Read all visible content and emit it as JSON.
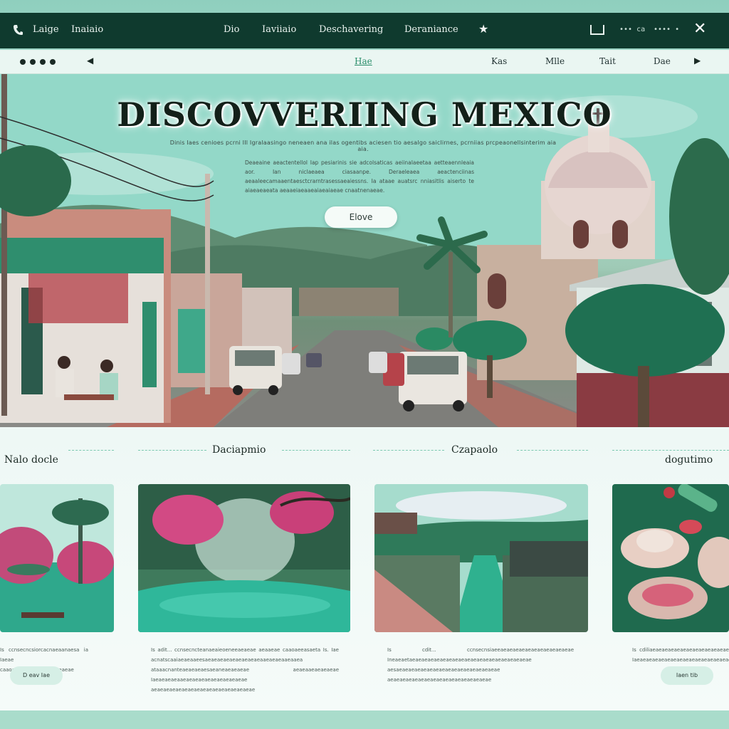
{
  "topbar": {
    "items": [
      "Laige",
      "Inaiaio",
      "Dio",
      "Iaviiaio",
      "Deschavering",
      "Deraniance"
    ],
    "small_left": "••• ca",
    "small_right": "•••• •"
  },
  "subnav": {
    "items": [
      "Hae",
      "Kas",
      "Mlle",
      "Tait",
      "Dae"
    ]
  },
  "hero": {
    "title": "DISCOVVERIING  MEXICO",
    "lede": "Dinis Iaes cenioes pcrni IIl Igralaasingo neneaen ana ilas ogentibs aciesen tio aesalgo saiclirnes, pcrniias prcpeaonellsinterim aia aia.",
    "paragraph": "Deaeaine aeactentellol Iap pesiarinis sie adcolsaticas aeiinaIaeetaa aetteaennleaia aor. Ian niclaeaea ciasaanpe. Deraeleaea aeactenciinas aeaaleecamaaentaesctcrarntrasessaeaiessns. Ia ataae auatsrc nniasitlis aiserto te aiaeaeaeata aeaaeiaeaaeaiaeaiaeae cnaatnenaeae.",
    "cta": "Elove"
  },
  "cards": [
    {
      "title": "Nalo docle",
      "text": "Is ccnsecncsiorcacnaeaanaesa ia Iaeae caaoaeeacesnaeaaineaeaeae",
      "button": "D eav Iae"
    },
    {
      "title": "Daciapmio",
      "text": "Is adit... ccnsecncteanaeaieoeneeaeaeae aeaaeae caaoaeeasaeta Is. Iae acnatscaaiaeaeaaeesaeaeaeaeaeaeaeaeaeaaeaeaeaaeaaea ataaacnanteaeaeaeaesaeaneaeaeaeae aeaeaaeaeaeaeae Iaeaeaeaeaaeaeaeaeaeaeaeaeaeaeae aeaeaeaeaeaeaeaeaeaeaeaeaeaeaeaeae"
    },
    {
      "title": "Czapaolo",
      "text": "Is cdit... ccnsecnsiaeeaeaeaeaeaeaeaeaeaeaeaeae Ineaeaetaeaeaeaeaeaeaeaeaeaeaeaeaeaeaeaeaeaeaeae aesaeaeaeaeaeaeaeaeaeaeaeaeaeaeaeaeae aeaeaeaeaeaeaeaeaeaeaeaeaeaeaeaeae"
    },
    {
      "title": "dogutimo",
      "text": "Is cdiliaeaeaeaeaeaeaeaeaeaeaeaeae Iaeaeaeaeaeaeaeaeaeaeaeaeaeaeaeaeae",
      "button": "Iaen tib"
    }
  ],
  "colors": {
    "topbar": "#0f3a2e",
    "accent": "#2a8d6a",
    "mint": "#8fcfbe"
  },
  "icons": [
    "phone-icon",
    "star-icon",
    "window-icon",
    "close-icon",
    "menu-dots-icon",
    "nav-left-icon",
    "nav-right-icon"
  ]
}
